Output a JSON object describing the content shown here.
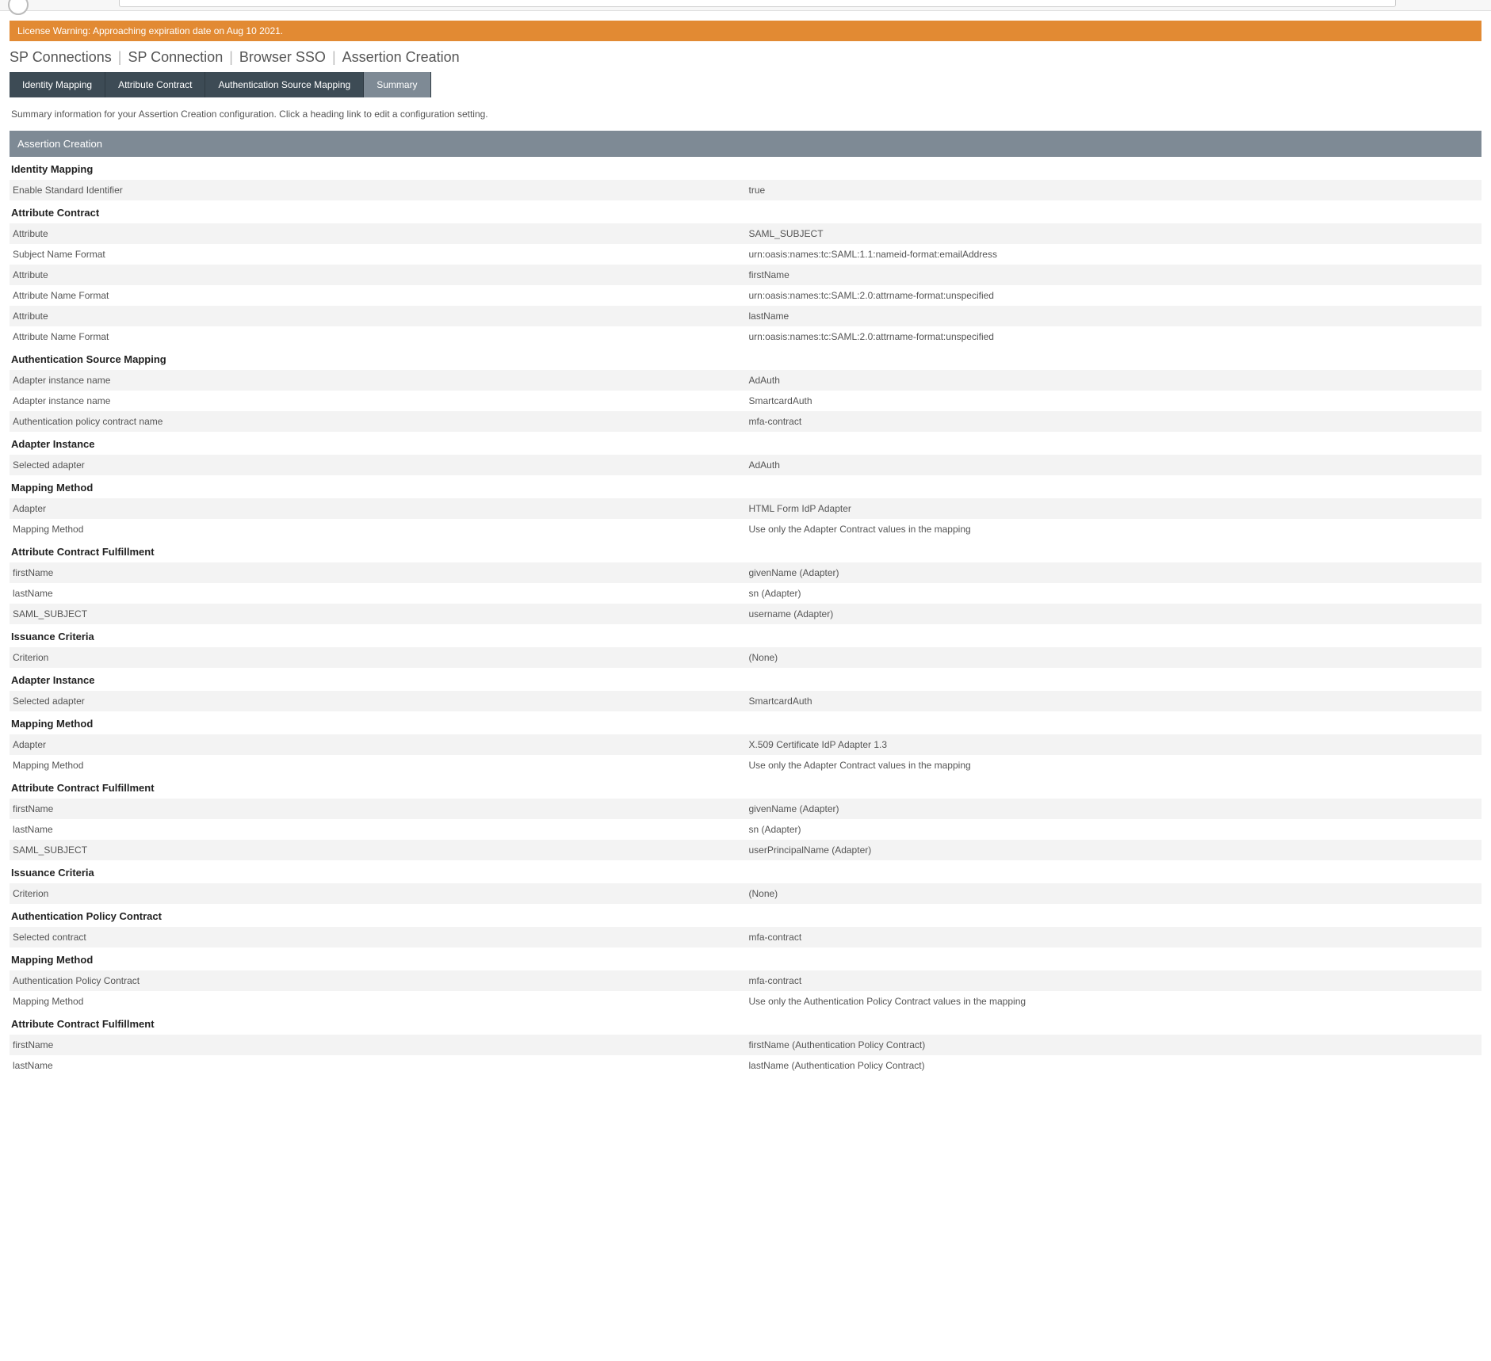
{
  "warning_banner": "License Warning: Approaching expiration date on Aug 10 2021.",
  "breadcrumb": [
    "SP Connections",
    "SP Connection",
    "Browser SSO",
    "Assertion Creation"
  ],
  "tabs": [
    {
      "label": "Identity Mapping",
      "active": false
    },
    {
      "label": "Attribute Contract",
      "active": false
    },
    {
      "label": "Authentication Source Mapping",
      "active": false
    },
    {
      "label": "Summary",
      "active": true
    }
  ],
  "summary_intro": "Summary information for your Assertion Creation configuration. Click a heading link to edit a configuration setting.",
  "section_header": "Assertion Creation",
  "groups": [
    {
      "heading": "Identity Mapping",
      "rows": [
        {
          "k": "Enable Standard Identifier",
          "v": "true"
        }
      ]
    },
    {
      "heading": "Attribute Contract",
      "rows": [
        {
          "k": "Attribute",
          "v": "SAML_SUBJECT"
        },
        {
          "k": "Subject Name Format",
          "v": "urn:oasis:names:tc:SAML:1.1:nameid-format:emailAddress"
        },
        {
          "k": "Attribute",
          "v": "firstName"
        },
        {
          "k": "Attribute Name Format",
          "v": "urn:oasis:names:tc:SAML:2.0:attrname-format:unspecified"
        },
        {
          "k": "Attribute",
          "v": "lastName"
        },
        {
          "k": "Attribute Name Format",
          "v": "urn:oasis:names:tc:SAML:2.0:attrname-format:unspecified"
        }
      ]
    },
    {
      "heading": "Authentication Source Mapping",
      "rows": [
        {
          "k": "Adapter instance name",
          "v": "AdAuth"
        },
        {
          "k": "Adapter instance name",
          "v": "SmartcardAuth"
        },
        {
          "k": "Authentication policy contract name",
          "v": "mfa-contract"
        }
      ]
    },
    {
      "heading": "Adapter Instance",
      "rows": [
        {
          "k": "Selected adapter",
          "v": "AdAuth"
        }
      ]
    },
    {
      "heading": "Mapping Method",
      "rows": [
        {
          "k": "Adapter",
          "v": "HTML Form IdP Adapter"
        },
        {
          "k": "Mapping Method",
          "v": "Use only the Adapter Contract values in the mapping"
        }
      ]
    },
    {
      "heading": "Attribute Contract Fulfillment",
      "rows": [
        {
          "k": "firstName",
          "v": "givenName (Adapter)"
        },
        {
          "k": "lastName",
          "v": "sn (Adapter)"
        },
        {
          "k": "SAML_SUBJECT",
          "v": "username (Adapter)"
        }
      ]
    },
    {
      "heading": "Issuance Criteria",
      "rows": [
        {
          "k": "Criterion",
          "v": "(None)"
        }
      ]
    },
    {
      "heading": "Adapter Instance",
      "rows": [
        {
          "k": "Selected adapter",
          "v": "SmartcardAuth"
        }
      ]
    },
    {
      "heading": "Mapping Method",
      "rows": [
        {
          "k": "Adapter",
          "v": "X.509 Certificate IdP Adapter 1.3"
        },
        {
          "k": "Mapping Method",
          "v": "Use only the Adapter Contract values in the mapping"
        }
      ]
    },
    {
      "heading": "Attribute Contract Fulfillment",
      "rows": [
        {
          "k": "firstName",
          "v": "givenName (Adapter)"
        },
        {
          "k": "lastName",
          "v": "sn (Adapter)"
        },
        {
          "k": "SAML_SUBJECT",
          "v": "userPrincipalName (Adapter)"
        }
      ]
    },
    {
      "heading": "Issuance Criteria",
      "rows": [
        {
          "k": "Criterion",
          "v": "(None)"
        }
      ]
    },
    {
      "heading": "Authentication Policy Contract",
      "rows": [
        {
          "k": "Selected contract",
          "v": "mfa-contract"
        }
      ]
    },
    {
      "heading": "Mapping Method",
      "rows": [
        {
          "k": "Authentication Policy Contract",
          "v": "mfa-contract"
        },
        {
          "k": "Mapping Method",
          "v": "Use only the Authentication Policy Contract values in the mapping"
        }
      ]
    },
    {
      "heading": "Attribute Contract Fulfillment",
      "rows": [
        {
          "k": "firstName",
          "v": "firstName (Authentication Policy Contract)"
        },
        {
          "k": "lastName",
          "v": "lastName (Authentication Policy Contract)"
        }
      ]
    }
  ]
}
